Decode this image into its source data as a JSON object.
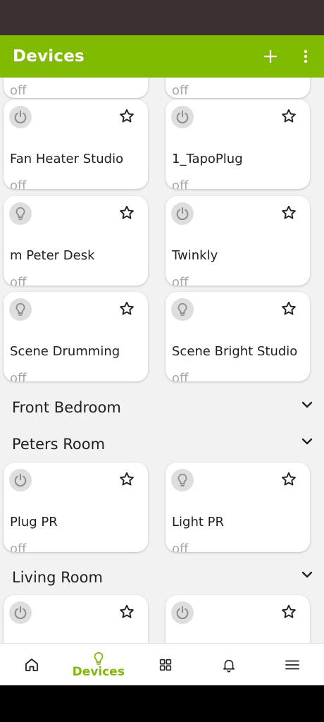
{
  "app_bar": {
    "title": "Devices"
  },
  "top_partial_cards": [
    {
      "state": "off"
    },
    {
      "state": "off"
    }
  ],
  "devices": [
    {
      "name": "Fan Heater Studio",
      "state": "off",
      "icon": "power-icon"
    },
    {
      "name": "1_TapoPlug",
      "state": "off",
      "icon": "power-icon"
    },
    {
      "name": "m Peter Desk",
      "state": "off",
      "icon": "bulb-icon"
    },
    {
      "name": "Twinkly",
      "state": "off",
      "icon": "power-icon"
    },
    {
      "name": "Scene Drumming",
      "state": "off",
      "icon": "bulb-icon"
    },
    {
      "name": "Scene Bright Studio",
      "state": "off",
      "icon": "bulb-icon"
    }
  ],
  "sections": {
    "front_bedroom": {
      "label": "Front Bedroom"
    },
    "peters_room": {
      "label": "Peters Room",
      "devices": [
        {
          "name": "Plug PR",
          "state": "off",
          "icon": "power-icon"
        },
        {
          "name": "Light PR",
          "state": "off",
          "icon": "bulb-icon"
        }
      ]
    },
    "living_room": {
      "label": "Living Room"
    }
  },
  "bottom_nav": {
    "active_label": "Devices"
  },
  "colors": {
    "accent": "#80bb00",
    "status_bar": "#3b2f2f",
    "card": "#ffffff",
    "background": "#f2f2f2",
    "off_text": "#a8a8a8"
  }
}
